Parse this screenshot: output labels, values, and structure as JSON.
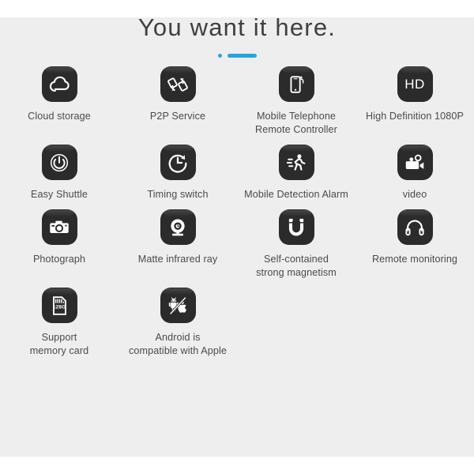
{
  "header": {
    "title": "You want it here.",
    "accent_color": "#29a3e0",
    "dot_icon": "accent-dot",
    "bar_icon": "accent-bar"
  },
  "theme": {
    "page_background": "#ffffff",
    "panel_background": "#eeeeee",
    "icon_background": "#2b2b2b",
    "icon_glyph_color": "#ffffff",
    "label_color": "#4a4a4a",
    "title_color": "#3f3f3f"
  },
  "features": {
    "rows": [
      [
        {
          "icon": "cloud-icon",
          "label_lines": [
            "Cloud storage"
          ]
        },
        {
          "icon": "p2p-transfer-icon",
          "label_lines": [
            "P2P Service"
          ]
        },
        {
          "icon": "smartphone-remote-icon",
          "label_lines": [
            "Mobile Telephone",
            "Remote Controller"
          ]
        },
        {
          "icon": "hd-badge-icon",
          "label_lines": [
            "High Definition 1080P"
          ],
          "glyph_text": "HD"
        }
      ],
      [
        {
          "icon": "power-button-icon",
          "label_lines": [
            "Easy Shuttle"
          ]
        },
        {
          "icon": "timer-clock-icon",
          "label_lines": [
            "Timing switch"
          ]
        },
        {
          "icon": "running-person-icon",
          "label_lines": [
            "Mobile Detection Alarm"
          ]
        },
        {
          "icon": "video-camera-icon",
          "label_lines": [
            "video"
          ]
        }
      ],
      [
        {
          "icon": "photo-camera-icon",
          "label_lines": [
            "Photograph"
          ]
        },
        {
          "icon": "webcam-icon",
          "label_lines": [
            "Matte infrared ray"
          ]
        },
        {
          "icon": "magnet-icon",
          "label_lines": [
            "Self-contained",
            "strong magnetism"
          ]
        },
        {
          "icon": "headphones-icon",
          "label_lines": [
            "Remote monitoring"
          ]
        }
      ],
      [
        {
          "icon": "memory-card-icon",
          "label_lines": [
            "Support",
            "memory card"
          ],
          "glyph_text": "128G"
        },
        {
          "icon": "android-apple-icon",
          "label_lines": [
            "Android is",
            "compatible  with Apple"
          ]
        },
        {
          "icon": "",
          "label_lines": []
        },
        {
          "icon": "",
          "label_lines": []
        }
      ]
    ]
  }
}
